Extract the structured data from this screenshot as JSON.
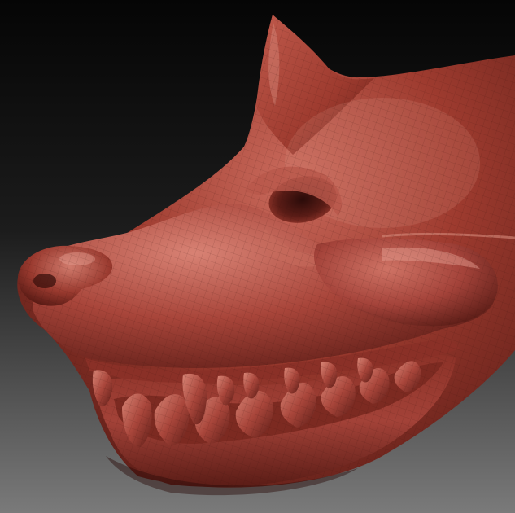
{
  "scene": {
    "subject": "sculpted-creature-head",
    "material": "clay",
    "colors": {
      "background_top": "#050505",
      "background_bottom": "#7a7a7a",
      "clay_base": "#9e3b2f",
      "clay_light": "#c96a5c",
      "clay_highlight": "#e29a8c",
      "clay_shadow": "#4a1612",
      "clay_deep": "#2a0b09"
    }
  }
}
